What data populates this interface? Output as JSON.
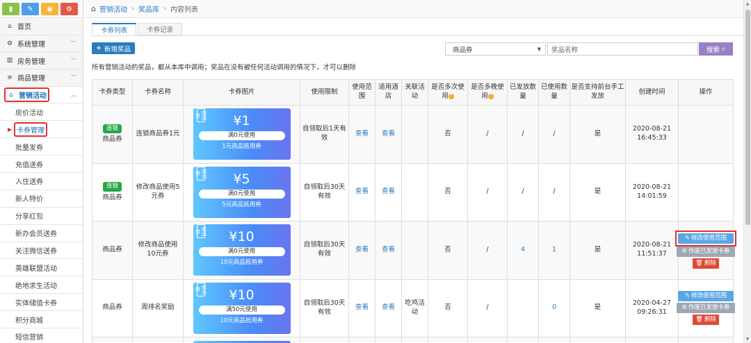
{
  "shortcuts": [
    {
      "icon": "chart-icon",
      "color": "#8bc34a",
      "glyph": "▮"
    },
    {
      "icon": "pencil-icon",
      "color": "#4f9ee8",
      "glyph": "✎"
    },
    {
      "icon": "users-icon",
      "color": "#f6b538",
      "glyph": "◉"
    },
    {
      "icon": "cogs-icon",
      "color": "#e05a47",
      "glyph": "⚙"
    }
  ],
  "sidebar": {
    "items": [
      {
        "label": "首页",
        "icon": "home-icon",
        "glyph": "⌂",
        "chevron": false
      },
      {
        "label": "系统管理",
        "icon": "gear-icon",
        "glyph": "⚙",
        "chevron": true
      },
      {
        "label": "房务管理",
        "icon": "building-icon",
        "glyph": "▥",
        "chevron": true
      },
      {
        "label": "商品管理",
        "icon": "database-icon",
        "glyph": "≡",
        "chevron": true
      },
      {
        "label": "营销活动",
        "icon": "gift-icon",
        "glyph": "⌂",
        "chevron": true,
        "active": true
      }
    ],
    "sub_items": [
      "房价活动",
      "卡券管理",
      "批量发券",
      "充值送券",
      "入住送券",
      "新人特价",
      "分享红包",
      "新办会员送券",
      "关注微信送券",
      "英雄联盟活动",
      "绝地求生活动",
      "实体储值卡券",
      "积分商城",
      "短信营销"
    ],
    "current_sub": "卡券管理"
  },
  "breadcrumb": {
    "home_icon": "home-icon",
    "items": [
      "营销活动",
      "奖品库",
      "内容列表"
    ]
  },
  "tabs": [
    "卡券列表",
    "卡券记录"
  ],
  "toolbar": {
    "add_label": "新增奖品",
    "select_value": "商品券",
    "search_placeholder": "奖品名称",
    "search_label": "搜索"
  },
  "notice": "所有营销活动的奖品，都从本库中调用；奖品在没有被任何活动调用的情况下，才可以删除",
  "table": {
    "headers": [
      "卡券类型",
      "卡券名称",
      "卡券图片",
      "使用限制",
      "使用范围",
      "适用酒店",
      "关联活动",
      "是否多次使用",
      "是否多晚使用",
      "已发放数量",
      "已使用数量",
      "是否支持前台手工发放",
      "创建时间",
      "操作"
    ],
    "rows": [
      {
        "badge": "连锁",
        "type": "商品券",
        "name": "连锁商品券1元",
        "coupon": {
          "tag": "商品券",
          "amount": "¥1",
          "threshold": "满0元使用",
          "desc": "1元商品抵用券"
        },
        "limit": "自领取后1天有效",
        "scope": "查看",
        "hotel": "查看",
        "activity": "",
        "multi": "否",
        "multinight": "/",
        "issued": "/",
        "used": "/",
        "manual": "是",
        "created": "2020-08-21 16:45:33",
        "ops": []
      },
      {
        "badge": "连锁",
        "type": "商品券",
        "name": "修改商品使用5元券",
        "coupon": {
          "tag": "商品券",
          "amount": "¥5",
          "threshold": "满0元使用",
          "desc": "5元商品抵用券"
        },
        "limit": "自领取后30天有效",
        "scope": "查看",
        "hotel": "查看",
        "activity": "",
        "multi": "否",
        "multinight": "/",
        "issued": "/",
        "used": "/",
        "manual": "是",
        "created": "2020-08-21 14:01:59",
        "ops": []
      },
      {
        "badge": "",
        "type": "商品券",
        "name": "修改商品使用10元券",
        "coupon": {
          "tag": "商品券",
          "amount": "¥10",
          "threshold": "满0元使用",
          "desc": "10元商品抵用券"
        },
        "limit": "自领取后30天有效",
        "scope": "查看",
        "hotel": "查看",
        "activity": "",
        "multi": "否",
        "multinight": "/",
        "issued": "4",
        "used": "1",
        "manual": "是",
        "created": "2020-08-21 11:51:37",
        "ops": [
          "修改使用范围",
          "作废已发放卡券",
          "删除"
        ],
        "highlight": true
      },
      {
        "badge": "",
        "type": "商品券",
        "name": "周排名奖励",
        "coupon": {
          "tag": "商品券",
          "amount": "¥10",
          "threshold": "满50元使用",
          "desc": "10元商品抵用券"
        },
        "limit": "自领取后30天有效",
        "scope": "查看",
        "hotel": "查看",
        "activity": "吃鸡活动",
        "multi": "否",
        "multinight": "/",
        "issued": "",
        "used": "0",
        "manual": "是",
        "created": "2020-04-27 09:26:31",
        "ops": [
          "修改使用范围",
          "作废已发放卡券",
          "删除"
        ]
      }
    ]
  }
}
